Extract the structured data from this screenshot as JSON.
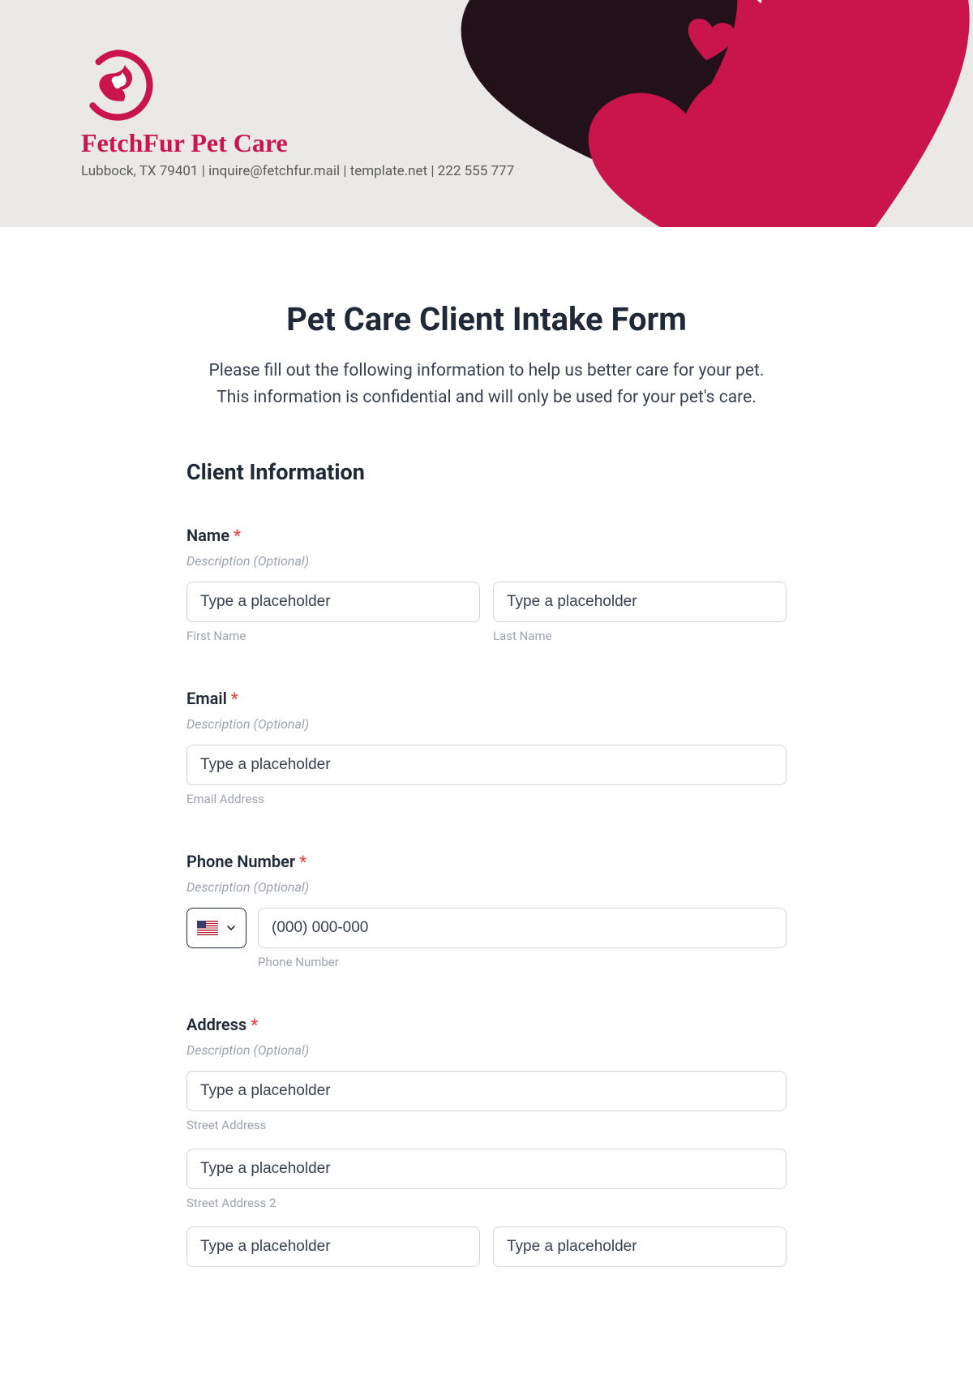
{
  "header": {
    "company_name": "FetchFur Pet Care",
    "info_line": "Lubbock, TX 79401 | inquire@fetchfur.mail | template.net | 222 555 777"
  },
  "form": {
    "title": "Pet Care Client Intake Form",
    "intro": "Please fill out the following information to help us better care for your pet. This information is confidential and will only be used for your pet's care.",
    "section_heading": "Client Information",
    "name": {
      "label": "Name",
      "required": "*",
      "desc": "Description (Optional)",
      "first_placeholder": "Type a placeholder",
      "last_placeholder": "Type a placeholder",
      "first_sub": "First Name",
      "last_sub": "Last Name"
    },
    "email": {
      "label": "Email",
      "required": "*",
      "desc": "Description (Optional)",
      "placeholder": "Type a placeholder",
      "sub": "Email Address"
    },
    "phone": {
      "label": "Phone Number",
      "required": "*",
      "desc": "Description (Optional)",
      "placeholder": "(000) 000-000",
      "sub": "Phone Number"
    },
    "address": {
      "label": "Address",
      "required": "*",
      "desc": "Description (Optional)",
      "street_placeholder": "Type a placeholder",
      "street_sub": "Street Address",
      "street2_placeholder": "Type a placeholder",
      "street2_sub": "Street Address 2",
      "city_placeholder": "Type a placeholder",
      "state_placeholder": "Type a placeholder"
    }
  }
}
